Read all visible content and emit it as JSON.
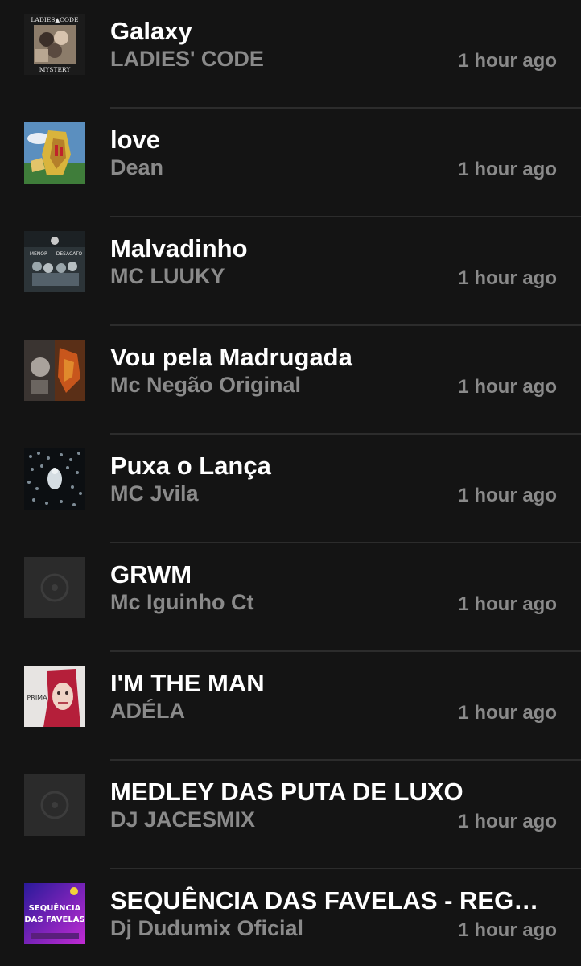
{
  "tracks": [
    {
      "title": "Galaxy",
      "artist": "LADIES' CODE",
      "time": "1 hour ago",
      "art": "ladies-code-mystery",
      "art_text_top": "LADIES▲CODE",
      "art_text_bottom": "MYSTERY"
    },
    {
      "title": "love",
      "artist": "Dean",
      "time": "1 hour ago",
      "art": "painting"
    },
    {
      "title": "Malvadinho",
      "artist": "MC LUUKY",
      "time": "1 hour ago",
      "art": "group-photo",
      "art_text_left": "MENOR",
      "art_text_right": "DESACATO"
    },
    {
      "title": "Vou pela Madrugada",
      "artist": "Mc Negão Original",
      "time": "1 hour ago",
      "art": "dark-collage"
    },
    {
      "title": "Puxa o Lança",
      "artist": "MC Jvila",
      "time": "1 hour ago",
      "art": "crowd"
    },
    {
      "title": "GRWM",
      "artist": "Mc Iguinho Ct",
      "time": "1 hour ago",
      "art": "placeholder-disc"
    },
    {
      "title": "I'M THE MAN",
      "artist": "ADÉLA",
      "time": "1 hour ago",
      "art": "portrait-red-hair",
      "art_text": "PRIMA"
    },
    {
      "title": "MEDLEY DAS PUTA DE LUXO",
      "artist": "DJ JACESMIX",
      "time": "1 hour ago",
      "art": "placeholder-disc"
    },
    {
      "title": "SEQUÊNCIA DAS FAVELAS - REGG...",
      "artist": "Dj Dudumix Oficial",
      "time": "1 hour ago",
      "art": "favelas-cover",
      "art_text_top": "SEQUÊNCIA",
      "art_text_bottom": "DAS FAVELAS"
    }
  ],
  "colors": {
    "background": "#141414",
    "title": "#ffffff",
    "secondary": "#8a8a8a",
    "divider": "#2c2c2c"
  }
}
